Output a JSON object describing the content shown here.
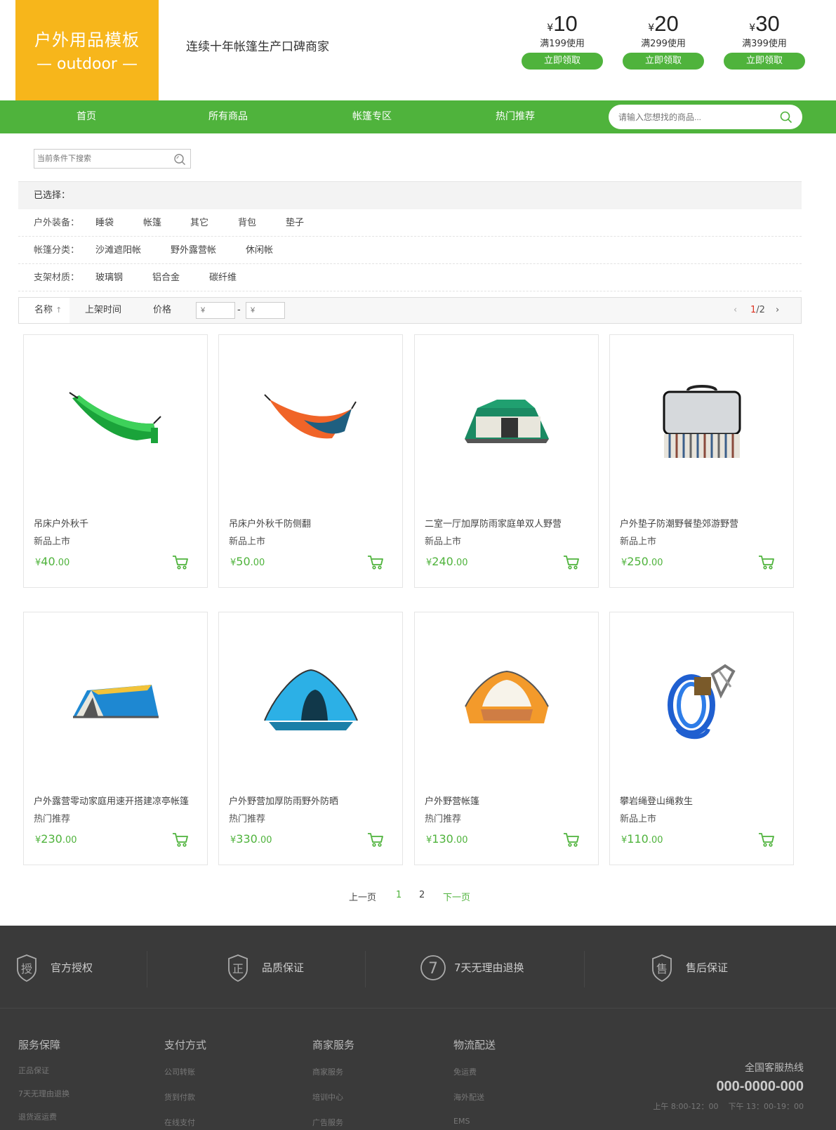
{
  "logo": {
    "line1": "户外用品模板",
    "line2": "— outdoor —"
  },
  "slogan": "连续十年帐篷生产口碑商家",
  "coupons": [
    {
      "yen": "¥",
      "amount": "10",
      "cond": "满199使用",
      "btn": "立即领取"
    },
    {
      "yen": "¥",
      "amount": "20",
      "cond": "满299使用",
      "btn": "立即领取"
    },
    {
      "yen": "¥",
      "amount": "30",
      "cond": "满399使用",
      "btn": "立即领取"
    }
  ],
  "nav": {
    "items": [
      "首页",
      "所有商品",
      "帐篷专区",
      "热门推荐"
    ],
    "search_placeholder": "请输入您想找的商品..."
  },
  "filter": {
    "search_placeholder": "当前条件下搜索",
    "selected_label": "已选择：",
    "rows": [
      {
        "label": "户外装备：",
        "options": [
          "睡袋",
          "帐篷",
          "其它",
          "背包",
          "垫子"
        ]
      },
      {
        "label": "帐篷分类：",
        "options": [
          "沙滩遮阳帐",
          "野外露营帐",
          "休闲帐"
        ]
      },
      {
        "label": "支架材质：",
        "options": [
          "玻璃钢",
          "铝合金",
          "碳纤维"
        ]
      }
    ]
  },
  "sort": {
    "name": "名称",
    "arrow": "↑",
    "time": "上架时间",
    "price": "价格",
    "min_ph": "¥",
    "max_ph": "¥",
    "dash": "-",
    "prev": "‹",
    "next": "›",
    "page_current": "1",
    "page_total": "/2"
  },
  "products": [
    {
      "name": "吊床户外秋千",
      "tag": "新品上市",
      "yen": "¥",
      "price": "40",
      "cents": ".00",
      "icon": "hammock-green"
    },
    {
      "name": "吊床户外秋千防侧翻",
      "tag": "新品上市",
      "yen": "¥",
      "price": "50",
      "cents": ".00",
      "icon": "hammock-orange"
    },
    {
      "name": "二室一厅加厚防雨家庭单双人野营",
      "tag": "新品上市",
      "yen": "¥",
      "price": "240",
      "cents": ".00",
      "icon": "tent-green"
    },
    {
      "name": "户外垫子防潮野餐垫郊游野营",
      "tag": "新品上市",
      "yen": "¥",
      "price": "250",
      "cents": ".00",
      "icon": "picnic-mat"
    },
    {
      "name": "户外露营零动家庭用速开搭建凉亭帐篷",
      "tag": "热门推荐",
      "yen": "¥",
      "price": "230",
      "cents": ".00",
      "icon": "tent-blue"
    },
    {
      "name": "户外野营加厚防雨野外防晒",
      "tag": "热门推荐",
      "yen": "¥",
      "price": "330",
      "cents": ".00",
      "icon": "tent-dome-blue"
    },
    {
      "name": "户外野营帐篷",
      "tag": "热门推荐",
      "yen": "¥",
      "price": "130",
      "cents": ".00",
      "icon": "tent-dome-orange"
    },
    {
      "name": "攀岩绳登山绳救生",
      "tag": "新品上市",
      "yen": "¥",
      "price": "110",
      "cents": ".00",
      "icon": "rope"
    }
  ],
  "pager": {
    "prev": "上一页",
    "p1": "1",
    "p2": "2",
    "next": "下一页"
  },
  "assurances": [
    {
      "glyph": "授",
      "label": "官方授权"
    },
    {
      "glyph": "正",
      "label": "品质保证"
    },
    {
      "glyph": "7",
      "label": "7天无理由退换"
    },
    {
      "glyph": "售",
      "label": "售后保证"
    }
  ],
  "footer_cols": [
    {
      "title": "服务保障",
      "links": [
        "正品保证",
        "7天无理由退换",
        "退货返运费"
      ]
    },
    {
      "title": "支付方式",
      "links": [
        "公司转账",
        "货到付款",
        "在线支付"
      ]
    },
    {
      "title": "商家服务",
      "links": [
        "商家服务",
        "培训中心",
        "广告服务"
      ]
    },
    {
      "title": "物流配送",
      "links": [
        "免运费",
        "海外配送",
        "EMS"
      ]
    }
  ],
  "hotline": {
    "label": "全国客服热线",
    "number": "000-0000-000",
    "am": "上午 8:00-12：00",
    "pm": "下午 13：00-19：00"
  },
  "colors": {
    "brand_green": "#4fb33c",
    "logo_orange": "#f7b61b",
    "footer": "#3a3a3a"
  }
}
